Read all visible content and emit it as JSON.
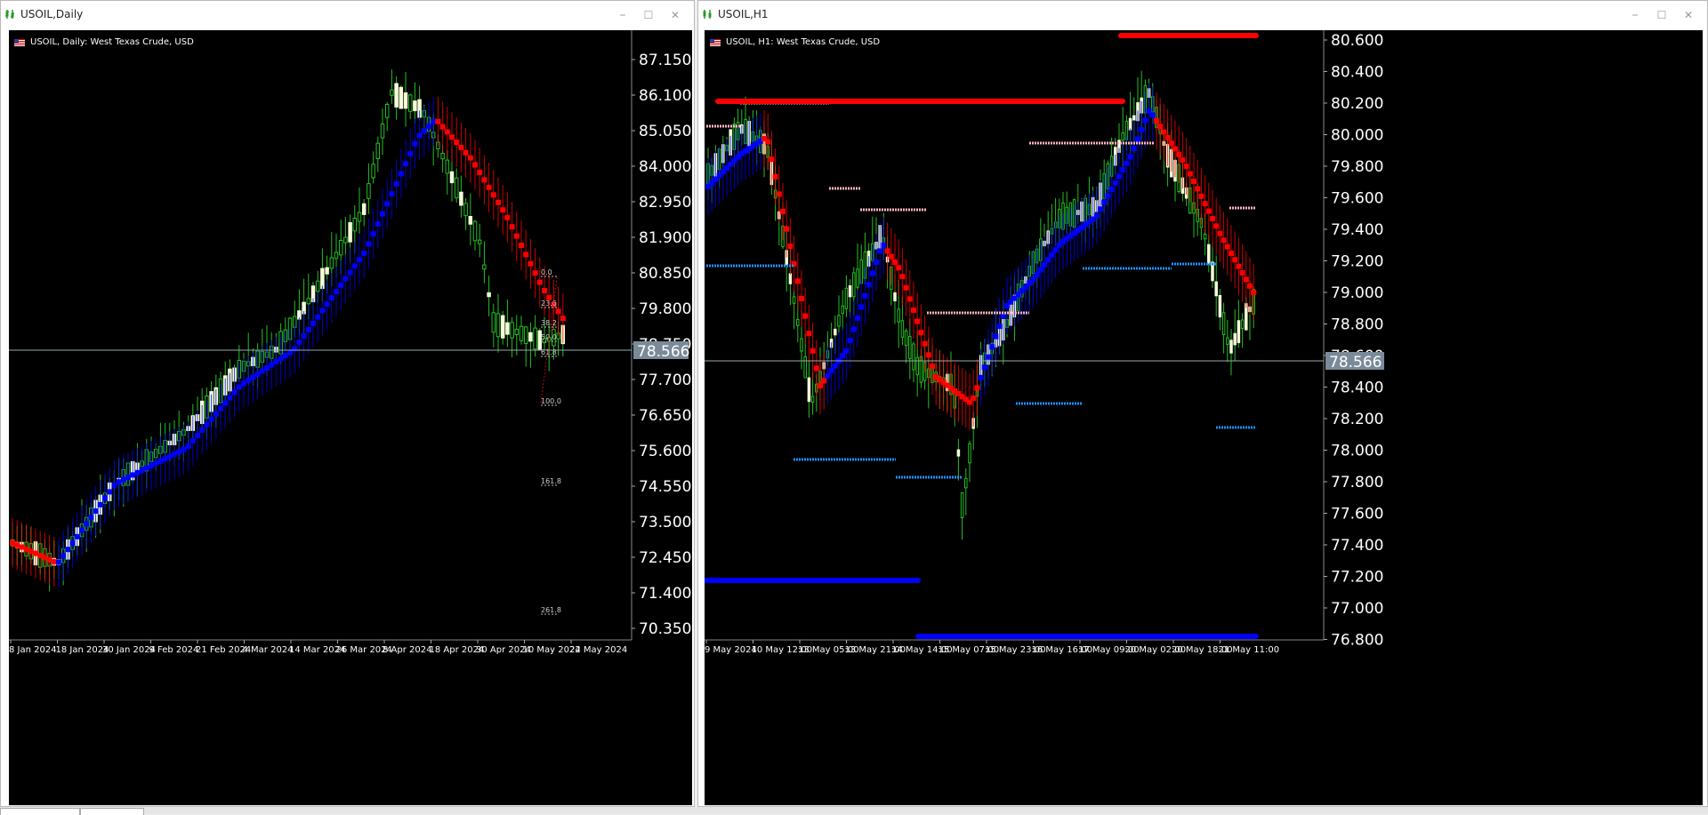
{
  "windows": [
    {
      "title": "USOIL,Daily",
      "symbol_desc": "USOIL, Daily:  West Texas Crude, USD",
      "controls": {
        "minimize": "–",
        "maximize": "☐",
        "close": "✕"
      },
      "price_labels": [
        "87.150",
        "86.100",
        "85.050",
        "84.000",
        "82.950",
        "81.900",
        "80.850",
        "79.800",
        "78.750",
        "77.700",
        "76.650",
        "75.600",
        "74.550",
        "73.500",
        "72.450",
        "71.400",
        "70.350"
      ],
      "current_price": "78.566",
      "time_labels": [
        "8 Jan 2024",
        "18 Jan 2024",
        "30 Jan 2024",
        "9 Feb 2024",
        "21 Feb 2024",
        "4 Mar 2024",
        "14 Mar 2024",
        "26 Mar 2024",
        "8 Apr 2024",
        "18 Apr 2024",
        "30 Apr 2024",
        "10 May 2024",
        "22 May 2024"
      ],
      "fib_levels": [
        "0.0",
        "23.6",
        "38.2",
        "50.0",
        "61.8",
        "100.0",
        "161.8",
        "261.8"
      ]
    },
    {
      "title": "USOIL,H1",
      "symbol_desc": "USOIL, H1:  West Texas Crude, USD",
      "controls": {
        "minimize": "–",
        "maximize": "☐",
        "close": "✕"
      },
      "price_labels": [
        "80.600",
        "80.400",
        "80.200",
        "80.000",
        "79.800",
        "79.600",
        "79.400",
        "79.200",
        "79.000",
        "78.800",
        "78.600",
        "78.400",
        "78.200",
        "78.000",
        "77.800",
        "77.600",
        "77.400",
        "77.200",
        "77.000",
        "76.800"
      ],
      "current_price": "78.566",
      "time_labels": [
        "9 May 2024",
        "10 May 12:00",
        "13 May 05:00",
        "13 May 21:00",
        "14 May 14:00",
        "15 May 07:00",
        "15 May 23:00",
        "16 May 16:00",
        "17 May 09:00",
        "20 May 02:00",
        "20 May 18:00",
        "21 May 11:00"
      ]
    }
  ],
  "colors": {
    "bull": "#22c022",
    "bull_body": "#f5ffd8",
    "band_up": "#0000ff",
    "band_down": "#ff0000",
    "resistance": "#ffb6c1",
    "support": "#1e90ff",
    "current_price_bg": "#7a8a99"
  }
}
